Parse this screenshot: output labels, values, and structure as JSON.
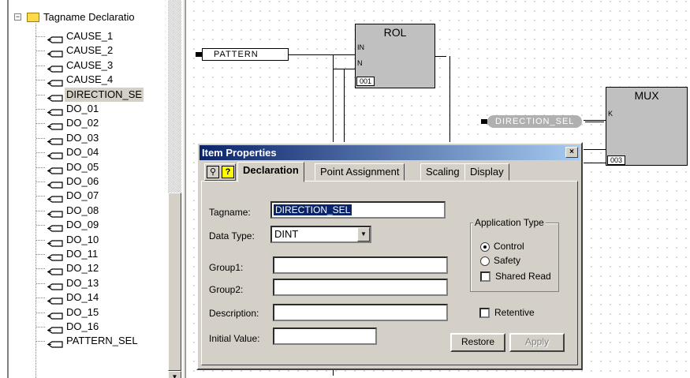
{
  "tree": {
    "root_label": "Tagname Declaratio",
    "items": [
      "CAUSE_1",
      "CAUSE_2",
      "CAUSE_3",
      "CAUSE_4",
      "DIRECTION_SE",
      "DO_01",
      "DO_02",
      "DO_03",
      "DO_04",
      "DO_05",
      "DO_06",
      "DO_07",
      "DO_08",
      "DO_09",
      "DO_10",
      "DO_11",
      "DO_12",
      "DO_13",
      "DO_14",
      "DO_15",
      "DO_16",
      "PATTERN_SEL"
    ],
    "selected_index": 4
  },
  "diagram": {
    "rol": {
      "title": "ROL",
      "pin_in": "IN",
      "pin_n": "N",
      "id": "001"
    },
    "mux": {
      "title": "MUX",
      "pin_k": "K",
      "id": "003"
    },
    "pattern_var": "PATTERN",
    "direction_var": "DIRECTION_SEL"
  },
  "dialog": {
    "title": "Item Properties",
    "close_glyph": "×",
    "tabs": [
      "Declaration",
      "Point Assignment",
      "Scaling",
      "Display"
    ],
    "active_tab": "Declaration",
    "fields": {
      "tagname_label": "Tagname:",
      "tagname_value": "DIRECTION_SEL",
      "datatype_label": "Data Type:",
      "datatype_value": "DINT",
      "group1_label": "Group1:",
      "group1_value": "",
      "group2_label": "Group2:",
      "group2_value": "",
      "description_label": "Description:",
      "description_value": "",
      "initial_value_label": "Initial Value:",
      "initial_value_value": ""
    },
    "app_type": {
      "legend": "Application Type",
      "control_label": "Control",
      "safety_label": "Safety",
      "shared_read_label": "Shared Read",
      "selected": "Control"
    },
    "retentive_label": "Retentive",
    "restore_label": "Restore",
    "apply_label": "Apply"
  }
}
